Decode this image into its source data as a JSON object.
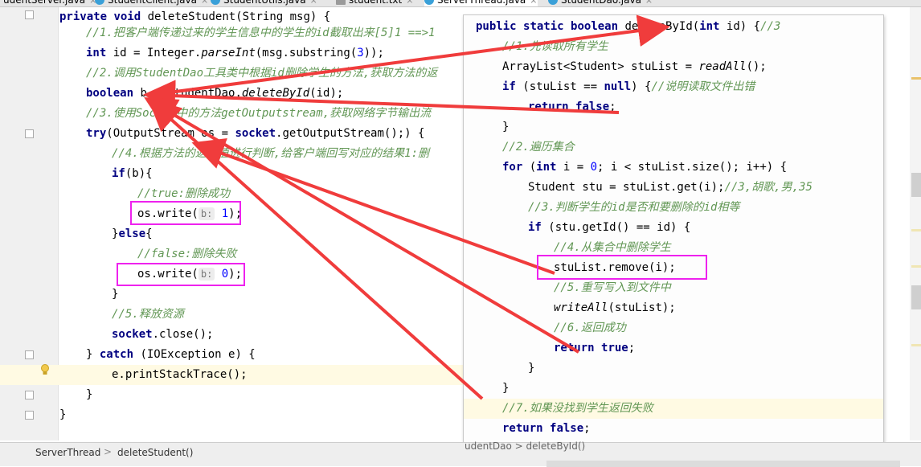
{
  "tabs": [
    {
      "label": "udentServer.java",
      "icon": "java-class-icon"
    },
    {
      "label": "StudentClient.java",
      "icon": "java-class-icon"
    },
    {
      "label": "StudentUtils.java",
      "icon": "java-class-icon"
    },
    {
      "label": "student.txt",
      "icon": "text-file-icon"
    },
    {
      "label": "ServerThread.java",
      "icon": "java-class-icon",
      "active": true
    },
    {
      "label": "StudentDao.java",
      "icon": "java-class-icon"
    }
  ],
  "editor": {
    "lines": [
      {
        "t": [
          {
            "c": "kw",
            "v": "private"
          },
          {
            "v": " "
          },
          {
            "c": "kw",
            "v": "void"
          },
          {
            "v": " deleteStudent(String msg) {"
          }
        ]
      },
      {
        "t": [
          {
            "c": "cm",
            "v": "//1.把客户端传递过来的学生信息中的学生的id截取出来[5]1 ==>1"
          }
        ]
      },
      {
        "t": [
          {
            "c": "kw",
            "v": "int"
          },
          {
            "v": " id = Integer."
          },
          {
            "c": "it",
            "v": "parseInt"
          },
          {
            "v": "(msg.substring("
          },
          {
            "c": "num",
            "v": "3"
          },
          {
            "v": "));"
          }
        ]
      },
      {
        "t": [
          {
            "c": "cm",
            "v": "//2.调用StudentDao工具类中根据id删除学生的方法,获取方法的返"
          }
        ]
      },
      {
        "t": [
          {
            "c": "kw",
            "v": "boolean"
          },
          {
            "v": " b = StudentDao."
          },
          {
            "c": "it",
            "v": "deleteById"
          },
          {
            "v": "(id);"
          }
        ]
      },
      {
        "t": [
          {
            "c": "cm",
            "v": "//3.使用Socket中的方法getOutputstream,获取网络字节输出流"
          }
        ]
      },
      {
        "t": [
          {
            "c": "kw",
            "v": "try"
          },
          {
            "v": "(OutputStream os = "
          },
          {
            "c": "kw",
            "v": "socket"
          },
          {
            "v": ".getOutputStream();) {"
          }
        ]
      },
      {
        "t": [
          {
            "c": "cm",
            "v": "//4.根据方法的返回值进行判断,给客户端回写对应的结果1:删"
          }
        ]
      },
      {
        "t": [
          {
            "c": "kw",
            "v": "if"
          },
          {
            "v": "(b){"
          }
        ]
      },
      {
        "t": [
          {
            "c": "cm",
            "v": "//true:删除成功"
          }
        ]
      },
      {
        "t": [
          {
            "v": "os.write("
          },
          {
            "c": "hint",
            "v": "b:"
          },
          {
            "c": "num",
            "v": " 1"
          },
          {
            "v": ");"
          }
        ]
      },
      {
        "t": [
          {
            "v": "}"
          },
          {
            "c": "kw",
            "v": "else"
          },
          {
            "v": "{"
          }
        ]
      },
      {
        "t": [
          {
            "c": "cm",
            "v": "//false:删除失败"
          }
        ]
      },
      {
        "t": [
          {
            "v": "os.write("
          },
          {
            "c": "hint",
            "v": "b:"
          },
          {
            "c": "num",
            "v": " 0"
          },
          {
            "v": ");"
          }
        ]
      },
      {
        "t": [
          {
            "v": "}"
          }
        ]
      },
      {
        "t": [
          {
            "c": "cm",
            "v": "//5.释放资源"
          }
        ]
      },
      {
        "t": [
          {
            "c": "kw",
            "v": "socket"
          },
          {
            "v": ".close();"
          }
        ]
      },
      {
        "t": [
          {
            "v": "} "
          },
          {
            "c": "kw",
            "v": "catch"
          },
          {
            "v": " (IOException e) {"
          }
        ]
      },
      {
        "t": [
          {
            "v": "e.printStackTrace();"
          }
        ]
      },
      {
        "t": [
          {
            "v": "}"
          }
        ]
      },
      {
        "t": [
          {
            "v": "}"
          }
        ]
      }
    ]
  },
  "popup": {
    "lines": [
      {
        "t": [
          {
            "c": "kw",
            "v": "public"
          },
          {
            "v": " "
          },
          {
            "c": "kw",
            "v": "static"
          },
          {
            "v": " "
          },
          {
            "c": "kw",
            "v": "boolean"
          },
          {
            "v": " deleteById("
          },
          {
            "c": "kw",
            "v": "int"
          },
          {
            "v": " id) {"
          },
          {
            "c": "cm",
            "v": "//3"
          }
        ]
      },
      {
        "t": [
          {
            "c": "cm",
            "v": "//1.先读取所有学生"
          }
        ]
      },
      {
        "t": [
          {
            "v": "ArrayList<Student> stuList = "
          },
          {
            "c": "it",
            "v": "readAll"
          },
          {
            "v": "();"
          }
        ]
      },
      {
        "t": [
          {
            "c": "kw",
            "v": "if"
          },
          {
            "v": " (stuList == "
          },
          {
            "c": "kw",
            "v": "null"
          },
          {
            "v": ") {"
          },
          {
            "c": "cm",
            "v": "//说明读取文件出错"
          }
        ]
      },
      {
        "t": [
          {
            "c": "kw",
            "v": "return"
          },
          {
            "v": " "
          },
          {
            "c": "kw",
            "v": "false"
          },
          {
            "v": ";"
          }
        ]
      },
      {
        "t": [
          {
            "v": "}"
          }
        ]
      },
      {
        "t": [
          {
            "c": "cm",
            "v": "//2.遍历集合"
          }
        ]
      },
      {
        "t": [
          {
            "c": "kw",
            "v": "for"
          },
          {
            "v": " ("
          },
          {
            "c": "kw",
            "v": "int"
          },
          {
            "v": " i = "
          },
          {
            "c": "num",
            "v": "0"
          },
          {
            "v": "; i < stuList.size(); i++) {"
          }
        ]
      },
      {
        "t": [
          {
            "v": "Student stu = stuList.get(i);"
          },
          {
            "c": "cm",
            "v": "//3,胡歌,男,35"
          }
        ]
      },
      {
        "t": [
          {
            "c": "cm",
            "v": "//3.判断学生的id是否和要删除的id相等"
          }
        ]
      },
      {
        "t": [
          {
            "c": "kw",
            "v": "if"
          },
          {
            "v": " (stu.getId() == id) {"
          }
        ]
      },
      {
        "t": [
          {
            "c": "cm",
            "v": "//4.从集合中删除学生"
          }
        ]
      },
      {
        "t": [
          {
            "v": "stuList.remove(i);"
          }
        ]
      },
      {
        "t": [
          {
            "c": "cm",
            "v": "//5.重写写入到文件中"
          }
        ]
      },
      {
        "t": [
          {
            "c": "it",
            "v": "writeAll"
          },
          {
            "v": "(stuList);"
          }
        ]
      },
      {
        "t": [
          {
            "c": "cm",
            "v": "//6.返回成功"
          }
        ]
      },
      {
        "t": [
          {
            "c": "kw",
            "v": "return"
          },
          {
            "v": " "
          },
          {
            "c": "kw",
            "v": "true"
          },
          {
            "v": ";"
          }
        ]
      },
      {
        "t": [
          {
            "v": "}"
          }
        ]
      },
      {
        "t": [
          {
            "v": "}"
          }
        ]
      },
      {
        "t": [
          {
            "c": "cm",
            "v": "//7.如果没找到学生返回失败"
          }
        ]
      },
      {
        "t": [
          {
            "c": "kw",
            "v": "return"
          },
          {
            "v": " "
          },
          {
            "c": "kw",
            "v": "false"
          },
          {
            "v": ";"
          }
        ]
      },
      {
        "t": [
          {
            "v": "}"
          }
        ]
      }
    ]
  },
  "breadcrumb": {
    "items": [
      "ServerThread",
      "deleteStudent()"
    ],
    "popup_crumb": "udentDao > deleteById()"
  },
  "colors": {
    "annotation_arrow": "#f03c3c",
    "box_highlight": "#ee22ee",
    "comment": "#629755",
    "keyword": "#000080",
    "number": "#0000ff"
  }
}
